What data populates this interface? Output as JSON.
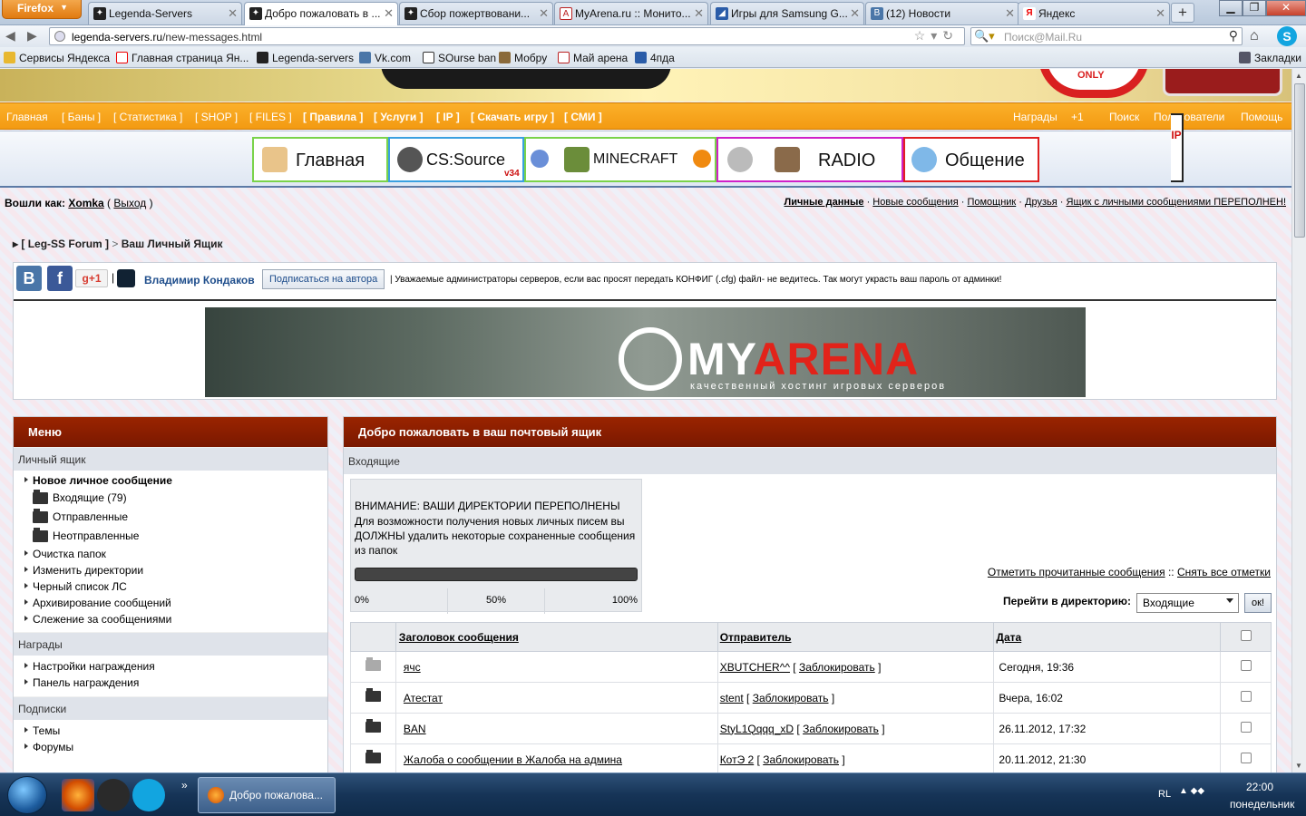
{
  "browser": {
    "app_button": "Firefox",
    "tabs": [
      {
        "title": "Legenda-Servers",
        "active": false
      },
      {
        "title": "Добро пожаловать в ...",
        "active": true
      },
      {
        "title": "Сбор пожертвовани...",
        "active": false
      },
      {
        "title": "MyArena.ru :: Монито...",
        "active": false
      },
      {
        "title": "Игры для Samsung G...",
        "active": false
      },
      {
        "title": "(12) Новости",
        "active": false
      },
      {
        "title": "Яндекс",
        "active": false
      }
    ],
    "url_domain": "legenda-servers.ru",
    "url_path": "/new-messages.html",
    "search_placeholder": "Поиск@Mail.Ru",
    "bookmarks": [
      "Сервисы Яндекса",
      "Главная страница Ян...",
      "Legenda-servers",
      "Vk.com",
      "SOurse ban",
      "Мобру",
      "Май арена",
      "4пда"
    ],
    "bookmarks_menu": "Закладки"
  },
  "site": {
    "banner_only": "ONLY",
    "top_menu_left": [
      "Главная",
      "[ Баны ]",
      "[ Статистика ]",
      "[ SHOP ]",
      "[ FILES ]",
      "[ Правила ]",
      "[ Услуги ]",
      "[ IP ]",
      "[ Скачать игру ]",
      "[ СМИ ]"
    ],
    "top_menu_right": [
      "Награды",
      "+1",
      "Поиск",
      "Пользователи",
      "Помощь"
    ],
    "big_menu": [
      "Главная",
      "CS:Source",
      "MINECRAFT",
      "RADIO",
      "Общение"
    ],
    "css_version": "v34",
    "ip_label": "IP",
    "login_prefix": "Вошли как:",
    "login_user": "Xomka",
    "logout": "Выход",
    "user_links": [
      "Личные данные",
      "Новые сообщения",
      "Помощник",
      "Друзья",
      "Ящик с личными сообщениями ПЕРЕПОЛНЕН!"
    ],
    "breadcrumb_root": "[ Leg-SS Forum ]",
    "breadcrumb_current": "Ваш Личный Ящик",
    "share": {
      "vk": "В",
      "fb": "f",
      "gplus": "g+1",
      "author": "Владимир Кондаков",
      "subscribe": "Подписаться на автора",
      "message": "| Уважаемые администраторы серверов, если вас просят передать КОНФИГ (.cfg) файл- не ведитесь. Так могут украсть ваш пароль от админки!"
    },
    "ad": {
      "title_white": "MY",
      "title_red": "ARENA",
      "subtitle": "качественный хостинг игровых серверов"
    }
  },
  "sidebar": {
    "title": "Меню",
    "sections": [
      {
        "title": "Личный ящик",
        "items": [
          {
            "type": "bold",
            "label": "Новое личное сообщение"
          },
          {
            "type": "folder",
            "label": "Входящие (79)"
          },
          {
            "type": "folder",
            "label": "Отправленные"
          },
          {
            "type": "folder",
            "label": "Неотправленные"
          },
          {
            "type": "link",
            "label": "Очистка папок"
          },
          {
            "type": "link",
            "label": "Изменить директории"
          },
          {
            "type": "link",
            "label": "Черный список ЛС"
          },
          {
            "type": "link",
            "label": "Архивирование сообщений"
          },
          {
            "type": "link",
            "label": "Слежение за сообщениями"
          }
        ]
      },
      {
        "title": "Награды",
        "items": [
          {
            "type": "link",
            "label": "Настройки награждения"
          },
          {
            "type": "link",
            "label": "Панель награждения"
          }
        ]
      },
      {
        "title": "Подписки",
        "items": [
          {
            "type": "link",
            "label": "Темы"
          },
          {
            "type": "link",
            "label": "Форумы"
          }
        ]
      }
    ]
  },
  "main": {
    "title": "Добро пожаловать в ваш почтовый ящик",
    "folder": "Входящие",
    "warning_title": "ВНИМАНИЕ: ВАШИ ДИРЕКТОРИИ ПЕРЕПОЛНЕНЫ",
    "warning_body": "Для возможности получения новых личных писем вы ДОЛЖНЫ удалить некоторые сохраненные сообщения из папок",
    "progress_fraction": 1.0,
    "progress_labels": [
      "0%",
      "50%",
      "100%"
    ],
    "mark_read": "Отметить прочитанные сообщения",
    "mark_sep": "::",
    "unmark_all": "Снять все отметки",
    "jump_label": "Перейти в директорию:",
    "jump_value": "Входящие",
    "ok": "ок!",
    "columns": [
      "Заголовок сообщения",
      "Отправитель",
      "Дата"
    ],
    "block_label": "Заблокировать",
    "messages": [
      {
        "subject": "ячс",
        "sender": "XBUTCHER^^",
        "date": "Сегодня, 19:36",
        "read": true
      },
      {
        "subject": "Атестат",
        "sender": "stent",
        "date": "Вчера, 16:02",
        "read": false
      },
      {
        "subject": "BAN",
        "sender": "StyL1Qqqq_xD",
        "date": "26.11.2012, 17:32",
        "read": false
      },
      {
        "subject": "Жалоба о сообщении в Жалоба на админа",
        "sender": "КотЭ 2",
        "date": "20.11.2012, 21:30",
        "read": false
      }
    ]
  },
  "taskbar": {
    "active_window": "Добро пожалова...",
    "lang": "RL",
    "time": "22:00",
    "day": "понедельник",
    "overflow": "»"
  },
  "colors": {
    "accent_orange": "#f39a12",
    "panel_header": "#8a1e00",
    "link_blue": "#1f4e8c"
  }
}
